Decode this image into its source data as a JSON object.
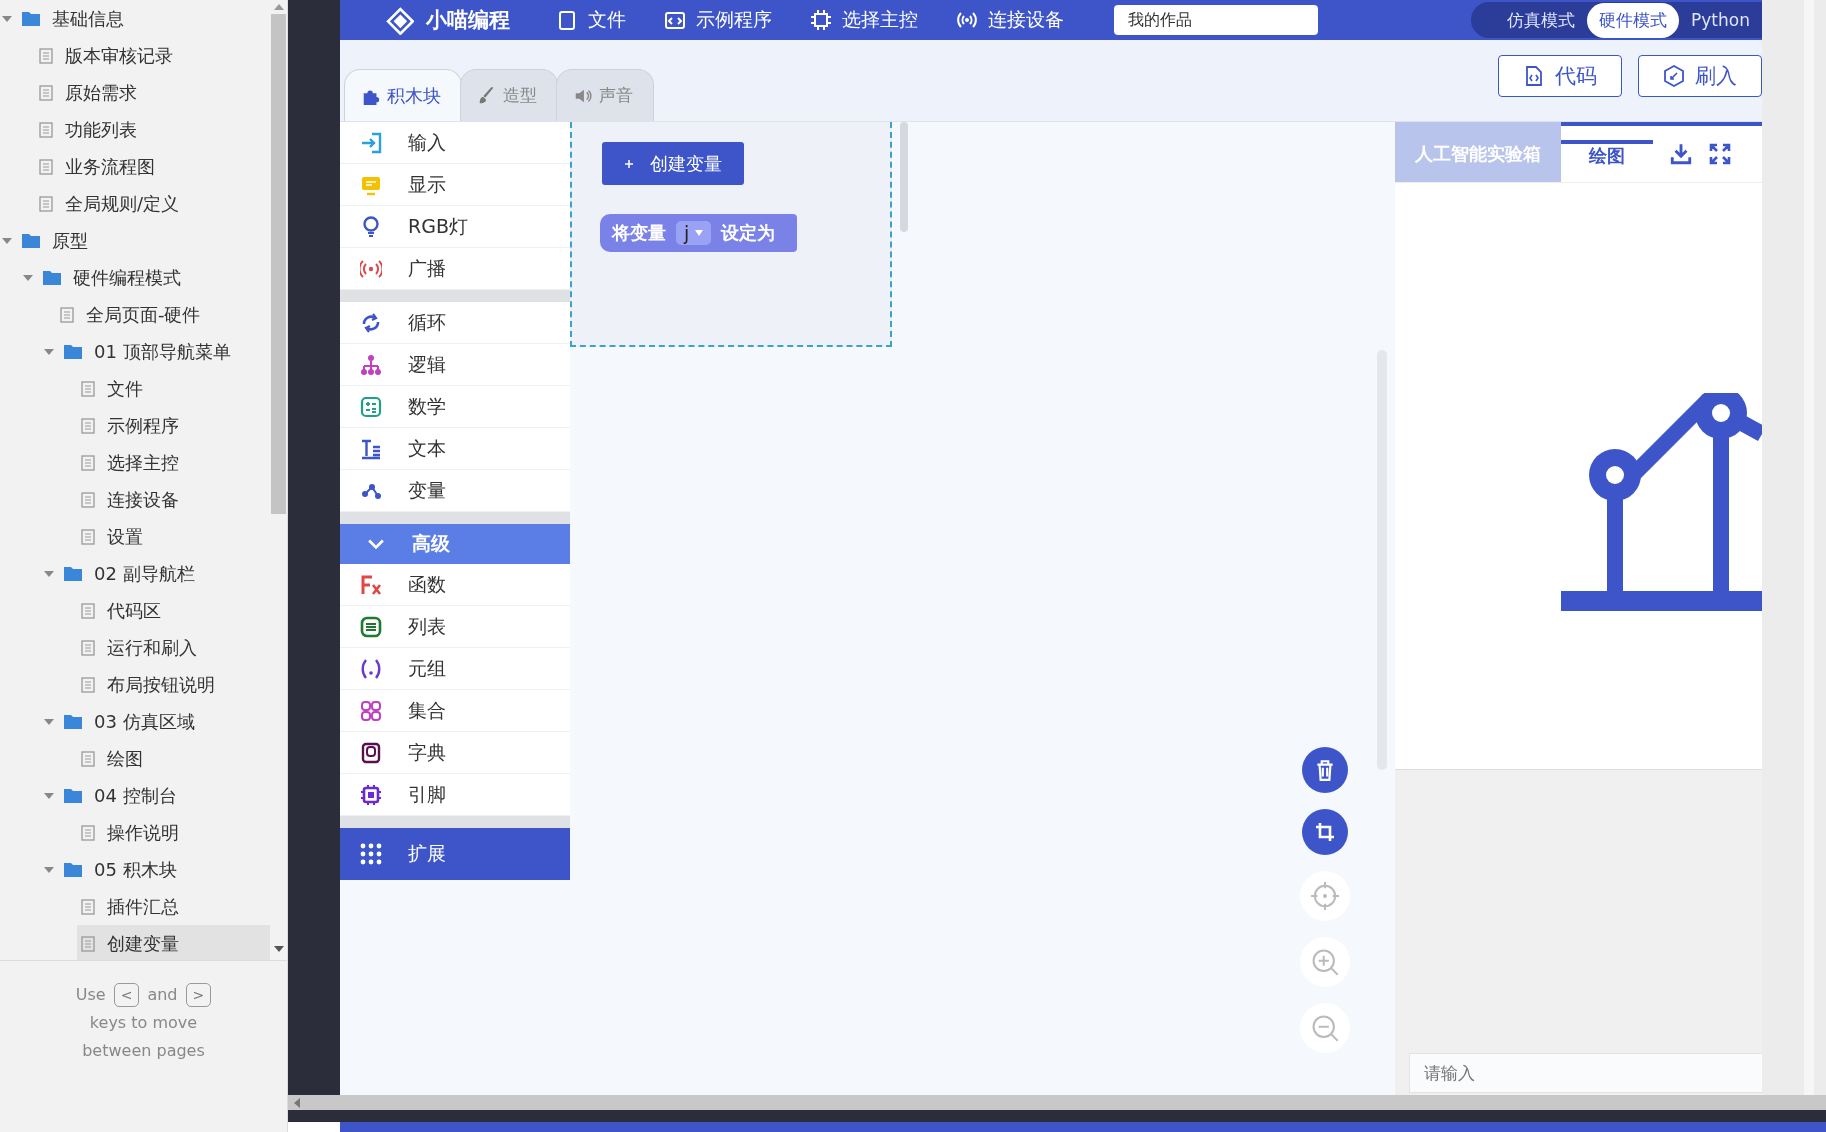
{
  "sidebar": {
    "tree": [
      {
        "kind": "folder",
        "label": "基础信息",
        "expanded": true,
        "selected": false,
        "children": [
          {
            "kind": "page",
            "label": "版本审核记录",
            "selected": false
          },
          {
            "kind": "page",
            "label": "原始需求",
            "selected": false
          },
          {
            "kind": "page",
            "label": "功能列表",
            "selected": false
          },
          {
            "kind": "page",
            "label": "业务流程图",
            "selected": false
          },
          {
            "kind": "page",
            "label": "全局规则/定义",
            "selected": false
          }
        ]
      },
      {
        "kind": "folder",
        "label": "原型",
        "expanded": true,
        "selected": false,
        "children": [
          {
            "kind": "folder",
            "label": "硬件编程模式",
            "expanded": true,
            "selected": false,
            "children": [
              {
                "kind": "page",
                "label": "全局页面-硬件",
                "selected": false
              },
              {
                "kind": "folder",
                "label": "01 顶部导航菜单",
                "expanded": true,
                "selected": false,
                "children": [
                  {
                    "kind": "page",
                    "label": "文件",
                    "selected": false
                  },
                  {
                    "kind": "page",
                    "label": "示例程序",
                    "selected": false
                  },
                  {
                    "kind": "page",
                    "label": "选择主控",
                    "selected": false
                  },
                  {
                    "kind": "page",
                    "label": "连接设备",
                    "selected": false
                  },
                  {
                    "kind": "page",
                    "label": "设置",
                    "selected": false
                  }
                ]
              },
              {
                "kind": "folder",
                "label": "02 副导航栏",
                "expanded": true,
                "selected": false,
                "children": [
                  {
                    "kind": "page",
                    "label": "代码区",
                    "selected": false
                  },
                  {
                    "kind": "page",
                    "label": "运行和刷入",
                    "selected": false
                  },
                  {
                    "kind": "page",
                    "label": "布局按钮说明",
                    "selected": false
                  }
                ]
              },
              {
                "kind": "folder",
                "label": "03 仿真区域",
                "expanded": true,
                "selected": false,
                "children": [
                  {
                    "kind": "page",
                    "label": "绘图",
                    "selected": false
                  }
                ]
              },
              {
                "kind": "folder",
                "label": "04 控制台",
                "expanded": true,
                "selected": false,
                "children": [
                  {
                    "kind": "page",
                    "label": "操作说明",
                    "selected": false
                  }
                ]
              },
              {
                "kind": "folder",
                "label": "05 积木块",
                "expanded": true,
                "selected": false,
                "children": [
                  {
                    "kind": "page",
                    "label": "插件汇总",
                    "selected": false
                  },
                  {
                    "kind": "page",
                    "label": "创建变量",
                    "selected": true
                  }
                ]
              }
            ]
          }
        ]
      }
    ],
    "help": {
      "before": "Use",
      "key_prev": "<",
      "middle": "and",
      "key_next": ">",
      "after": "keys to move between pages"
    }
  },
  "header": {
    "title": "小喵编程",
    "menu": [
      {
        "label": "文件"
      },
      {
        "label": "示例程序"
      },
      {
        "label": "选择主控"
      },
      {
        "label": "连接设备"
      }
    ],
    "search": {
      "value": "我的作品"
    },
    "modes": [
      {
        "label": "仿真模式",
        "selected": false
      },
      {
        "label": "硬件模式",
        "selected": true
      },
      {
        "label": "Python",
        "selected": false
      }
    ]
  },
  "editor_tabs": [
    {
      "label": "积木块",
      "selected": true
    },
    {
      "label": "造型",
      "selected": false
    },
    {
      "label": "声音",
      "selected": false
    }
  ],
  "actions": [
    {
      "label": "代码"
    },
    {
      "label": "刷入"
    }
  ],
  "palette": {
    "groups": [
      [
        {
          "label": "输入"
        },
        {
          "label": "显示"
        },
        {
          "label": "RGB灯"
        },
        {
          "label": "广播"
        }
      ],
      [
        {
          "label": "循环"
        },
        {
          "label": "逻辑"
        },
        {
          "label": "数学"
        },
        {
          "label": "文本"
        },
        {
          "label": "变量"
        }
      ]
    ],
    "advanced": {
      "label": "高级",
      "expanded": true,
      "items": [
        {
          "label": "函数"
        },
        {
          "label": "列表"
        },
        {
          "label": "元组"
        },
        {
          "label": "集合"
        },
        {
          "label": "字典"
        },
        {
          "label": "引脚"
        }
      ]
    },
    "extension": {
      "label": "扩展"
    }
  },
  "flyout": {
    "create_button": "创建变量",
    "block": {
      "prefix": "将变量",
      "variable": "j",
      "suffix": "设定为"
    }
  },
  "simulator": {
    "tabs": [
      {
        "label": "人工智能实验箱",
        "selected": false
      },
      {
        "label": "绘图",
        "selected": true
      }
    ],
    "console": {
      "placeholder": "请输入"
    }
  }
}
